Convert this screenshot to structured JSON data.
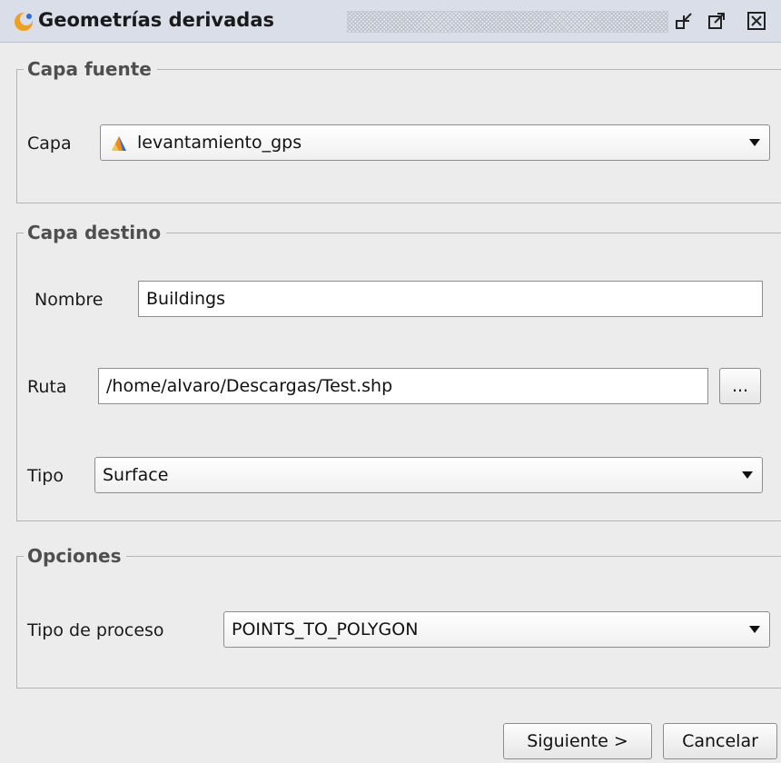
{
  "window": {
    "title": "Geometrías derivadas",
    "icons": {
      "app": "orange-crescent-icon",
      "minimize": "undock-icon",
      "maximize": "maximize-icon",
      "close": "close-icon"
    }
  },
  "source_group": {
    "legend": "Capa fuente",
    "layer_label": "Capa",
    "layer_value": "levantamiento_gps",
    "layer_icon": "point-layer-icon"
  },
  "target_group": {
    "legend": "Capa destino",
    "name_label": "Nombre",
    "name_value": "Buildings",
    "path_label": "Ruta",
    "path_value": "/home/alvaro/Descargas/Test.shp",
    "browse_label": "...",
    "type_label": "Tipo",
    "type_value": "Surface"
  },
  "options_group": {
    "legend": "Opciones",
    "process_label": "Tipo de proceso",
    "process_value": "POINTS_TO_POLYGON"
  },
  "buttons": {
    "next": "Siguiente >",
    "cancel": "Cancelar"
  },
  "colors": {
    "titlebar": "#d9dee8",
    "background": "#ececec",
    "app_icon_orange": "#f0a020",
    "layer_icon_blue": "#2a6fd6",
    "layer_icon_orange": "#f08a1a"
  }
}
